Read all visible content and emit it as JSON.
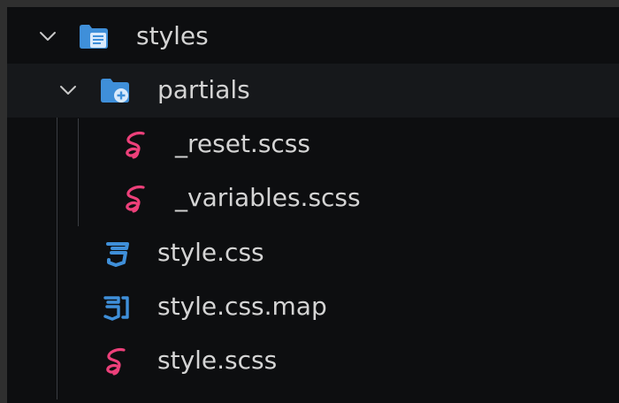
{
  "explorer": {
    "items": [
      {
        "label": "styles",
        "kind": "folder",
        "expanded": true,
        "icon": "folder-styles-icon",
        "icon_color": "#42a5f5"
      },
      {
        "label": "partials",
        "kind": "folder",
        "expanded": true,
        "icon": "folder-partials-icon",
        "icon_color": "#42a5f5"
      },
      {
        "label": "_reset.scss",
        "kind": "file",
        "icon": "sass-icon",
        "icon_color": "#ec407a"
      },
      {
        "label": "_variables.scss",
        "kind": "file",
        "icon": "sass-icon",
        "icon_color": "#ec407a"
      },
      {
        "label": "style.css",
        "kind": "file",
        "icon": "css-icon",
        "icon_color": "#42a5f5"
      },
      {
        "label": "style.css.map",
        "kind": "file",
        "icon": "css-map-icon",
        "icon_color": "#42a5f5"
      },
      {
        "label": "style.scss",
        "kind": "file",
        "icon": "sass-icon",
        "icon_color": "#ec407a"
      }
    ]
  }
}
